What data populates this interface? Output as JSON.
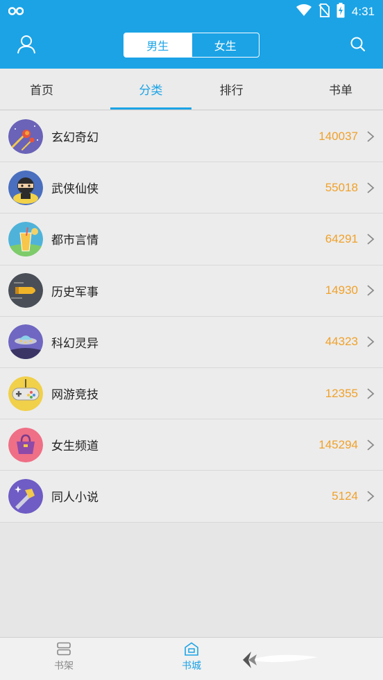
{
  "statusbar": {
    "time": "4:31"
  },
  "header": {
    "gender_toggle": {
      "male": "男生",
      "female": "女生",
      "selected": "男生"
    }
  },
  "tabs": [
    {
      "label": "首页"
    },
    {
      "label": "分类",
      "active": true
    },
    {
      "label": "排行"
    },
    {
      "label": "书单"
    }
  ],
  "categories": [
    {
      "label": "玄幻奇幻",
      "count": "140037",
      "icon": "meteor-icon"
    },
    {
      "label": "武侠仙侠",
      "count": "55018",
      "icon": "ninja-icon"
    },
    {
      "label": "都市言情",
      "count": "64291",
      "icon": "drink-icon"
    },
    {
      "label": "历史军事",
      "count": "14930",
      "icon": "bullet-icon"
    },
    {
      "label": "科幻灵异",
      "count": "44323",
      "icon": "ufo-icon"
    },
    {
      "label": "网游竞技",
      "count": "12355",
      "icon": "gamepad-icon"
    },
    {
      "label": "女生频道",
      "count": "145294",
      "icon": "handbag-icon"
    },
    {
      "label": "同人小说",
      "count": "5124",
      "icon": "magic-wand-icon"
    }
  ],
  "bottom_nav": [
    {
      "label": "书架",
      "icon": "bookshelf-icon"
    },
    {
      "label": "书城",
      "icon": "bookstore-icon",
      "active": true
    }
  ],
  "colors": {
    "accent": "#1ba3e6",
    "count": "#f0a12a"
  }
}
